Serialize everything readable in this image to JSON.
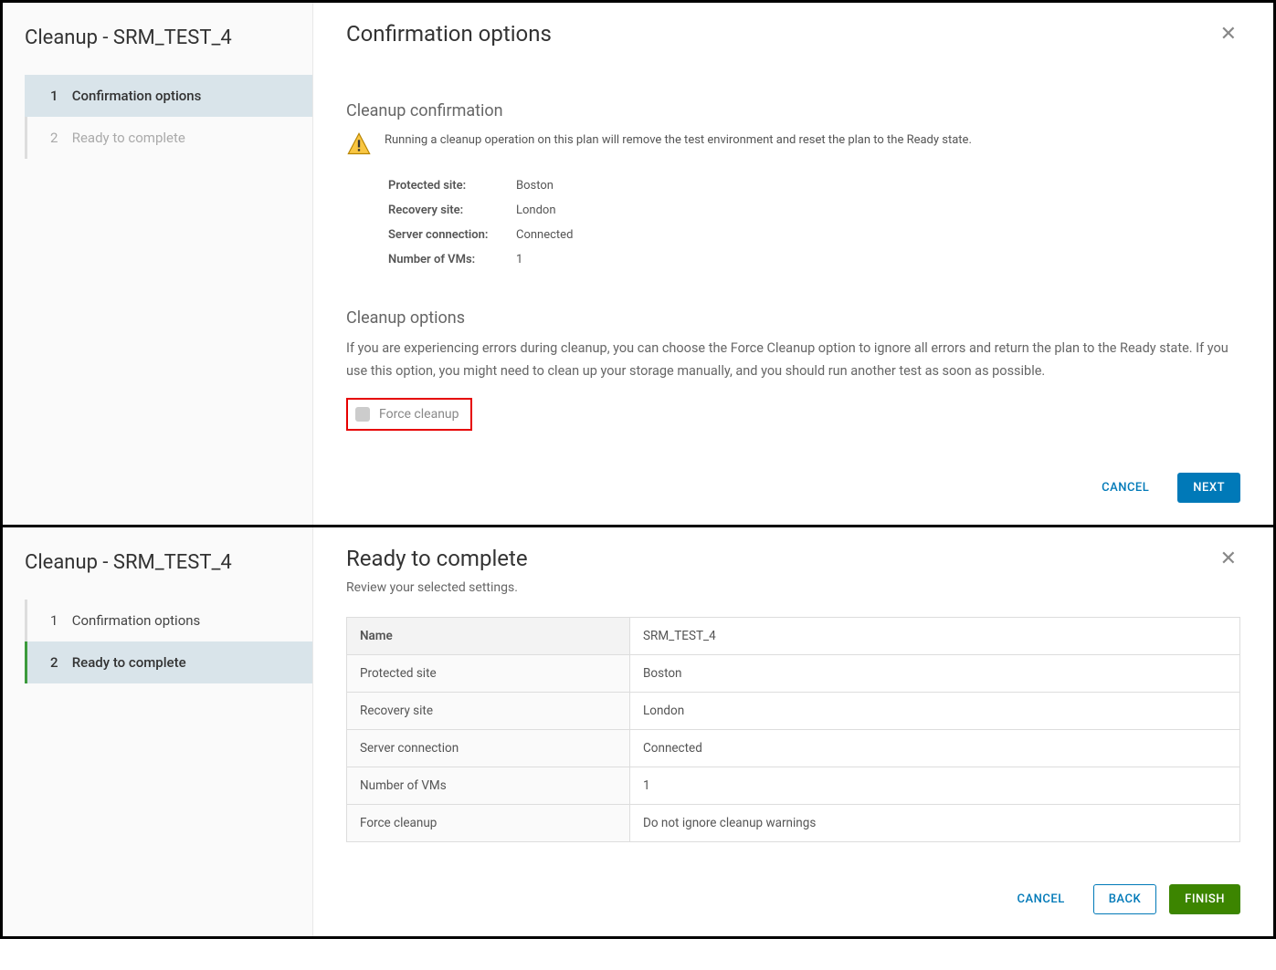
{
  "dialog1": {
    "sidebar_title": "Cleanup - SRM_TEST_4",
    "steps": [
      {
        "num": "1",
        "label": "Confirmation options"
      },
      {
        "num": "2",
        "label": "Ready to complete"
      }
    ],
    "main_title": "Confirmation options",
    "section1_title": "Cleanup confirmation",
    "warning_text": "Running a cleanup operation on this plan will remove the test environment and reset the plan to the Ready state.",
    "info": [
      {
        "label": "Protected site:",
        "value": "Boston"
      },
      {
        "label": "Recovery site:",
        "value": "London"
      },
      {
        "label": "Server connection:",
        "value": "Connected"
      },
      {
        "label": "Number of VMs:",
        "value": "1"
      }
    ],
    "section2_title": "Cleanup options",
    "section2_desc": "If you are experiencing errors during cleanup, you can choose the Force Cleanup option to ignore all errors and return the plan to the Ready state. If you use this option, you might need to clean up your storage manually, and you should run another test as soon as possible.",
    "checkbox_label": "Force cleanup",
    "cancel_label": "CANCEL",
    "next_label": "NEXT"
  },
  "dialog2": {
    "sidebar_title": "Cleanup - SRM_TEST_4",
    "steps": [
      {
        "num": "1",
        "label": "Confirmation options"
      },
      {
        "num": "2",
        "label": "Ready to complete"
      }
    ],
    "main_title": "Ready to complete",
    "main_subtitle": "Review your selected settings.",
    "rows": [
      {
        "label": "Name",
        "value": "SRM_TEST_4"
      },
      {
        "label": "Protected site",
        "value": "Boston"
      },
      {
        "label": "Recovery site",
        "value": "London"
      },
      {
        "label": "Server connection",
        "value": "Connected"
      },
      {
        "label": "Number of VMs",
        "value": "1"
      },
      {
        "label": "Force cleanup",
        "value": "Do not ignore cleanup warnings"
      }
    ],
    "cancel_label": "CANCEL",
    "back_label": "BACK",
    "finish_label": "FINISH"
  }
}
